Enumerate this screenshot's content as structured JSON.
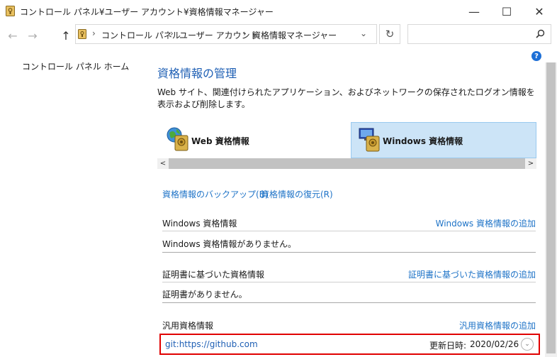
{
  "window": {
    "title": "コントロール パネル¥ユーザー アカウント¥資格情報マネージャー",
    "minimize": "—",
    "maximize": "☐",
    "close": "✕"
  },
  "nav": {
    "back": "←",
    "forward": "→",
    "up": "↑",
    "crumbs": [
      "コントロール パネル",
      "ユーザー アカウント",
      "資格情報マネージャー"
    ],
    "separator": "›",
    "dropdown": "⌄",
    "refresh": "↻",
    "search_placeholder": ""
  },
  "left_nav": {
    "home": "コントロール パネル ホーム"
  },
  "help": "?",
  "main": {
    "title": "資格情報の管理",
    "description": "Web サイト、関連付けられたアプリケーション、およびネットワークの保存されたログオン情報を表示および削除します。",
    "tabs": [
      {
        "label": "Web 資格情報",
        "selected": false
      },
      {
        "label": "Windows 資格情報",
        "selected": true
      }
    ],
    "scroll_left": "<",
    "scroll_right": ">",
    "backup_link": "資格情報のバックアップ(B)",
    "restore_link": "資格情報の復元(R)",
    "sections": [
      {
        "heading": "Windows 資格情報",
        "add": "Windows 資格情報の追加",
        "empty": "Windows 資格情報がありません。"
      },
      {
        "heading": "証明書に基づいた資格情報",
        "add": "証明書に基づいた資格情報の追加",
        "empty": "証明書がありません。"
      },
      {
        "heading": "汎用資格情報",
        "add": "汎用資格情報の追加"
      }
    ],
    "generic_entry": {
      "name": "git:https://github.com",
      "modified_label": "更新日時:",
      "modified_date": "2020/02/26",
      "expand": "⌄"
    }
  },
  "colors": {
    "accent": "#1e73c7",
    "selected_tab": "#cce4f7",
    "highlight": "#e00000"
  }
}
